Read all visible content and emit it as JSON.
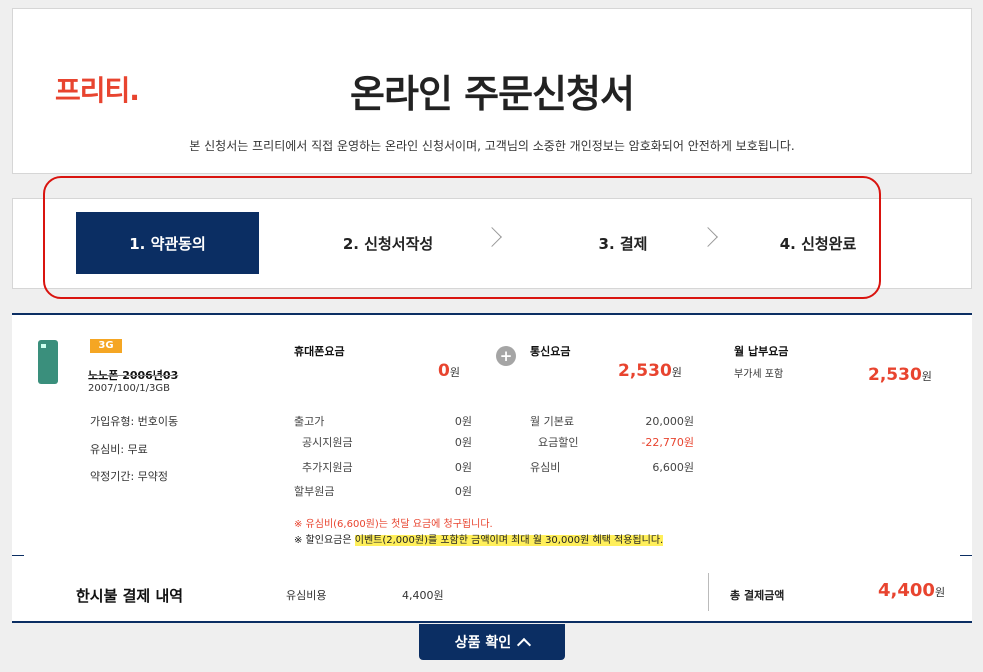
{
  "header": {
    "logo": "프리티.",
    "title": "온라인 주문신청서",
    "subtitle": "본 신청서는 프리티에서 직접 운영하는 온라인 신청서이며, 고객님의 소중한 개인정보는 암호화되어 안전하게 보호됩니다."
  },
  "steps": [
    {
      "label": "1. 약관동의",
      "active": true
    },
    {
      "label": "2. 신청서작성",
      "active": false
    },
    {
      "label": "3. 결제",
      "active": false
    },
    {
      "label": "4. 신청완료",
      "active": false
    }
  ],
  "product": {
    "badge": "3G",
    "name": "노노폰 2006년03",
    "sub": "2007/100/1/3GB",
    "lines": [
      "가입유형: 번호이동",
      "유심비: 무료",
      "약정기간: 무약정"
    ],
    "device_header": "휴대폰요금",
    "device_price": "0",
    "device_unit": "원",
    "plan_header": "통신요금",
    "plan_price": "2,530",
    "plan_unit": "원",
    "monthly_header": "월 납부요금",
    "monthly_sub": "부가세 포함",
    "monthly_total": "2,530",
    "monthly_unit": "원",
    "device_details": [
      {
        "label": "출고가",
        "value": "0원"
      },
      {
        "label": "공시지원금",
        "value": "0원"
      },
      {
        "label": "추가지원금",
        "value": "0원"
      },
      {
        "label": "할부원금",
        "value": "0원"
      }
    ],
    "plan_details": [
      {
        "label": "월 기본료",
        "value": "20,000원",
        "red": false
      },
      {
        "label": "요금할인",
        "value": "-22,770원",
        "red": true
      },
      {
        "label": "유심비",
        "value": "6,600원",
        "red": false
      }
    ],
    "note_red": "※ 유심비(6,600원)는 첫달 요금에 청구됩니다.",
    "note_yellow_prefix": "※ 할인요금은 ",
    "note_yellow_highlight": "이벤트(2,000원)를 포함한 금액이며 최대 월 30,000원 혜택 적용됩니다."
  },
  "summary": {
    "label": "한시불 결제 내역",
    "item_label": "유심비용",
    "item_value": "4,400원",
    "total_label": "총 결제금액",
    "total_value": "4,400",
    "total_unit": "원"
  },
  "confirm_button": "상품 확인",
  "colors": {
    "navy": "#0b2e63",
    "accent": "#e8442f",
    "ring": "#d9140f"
  }
}
